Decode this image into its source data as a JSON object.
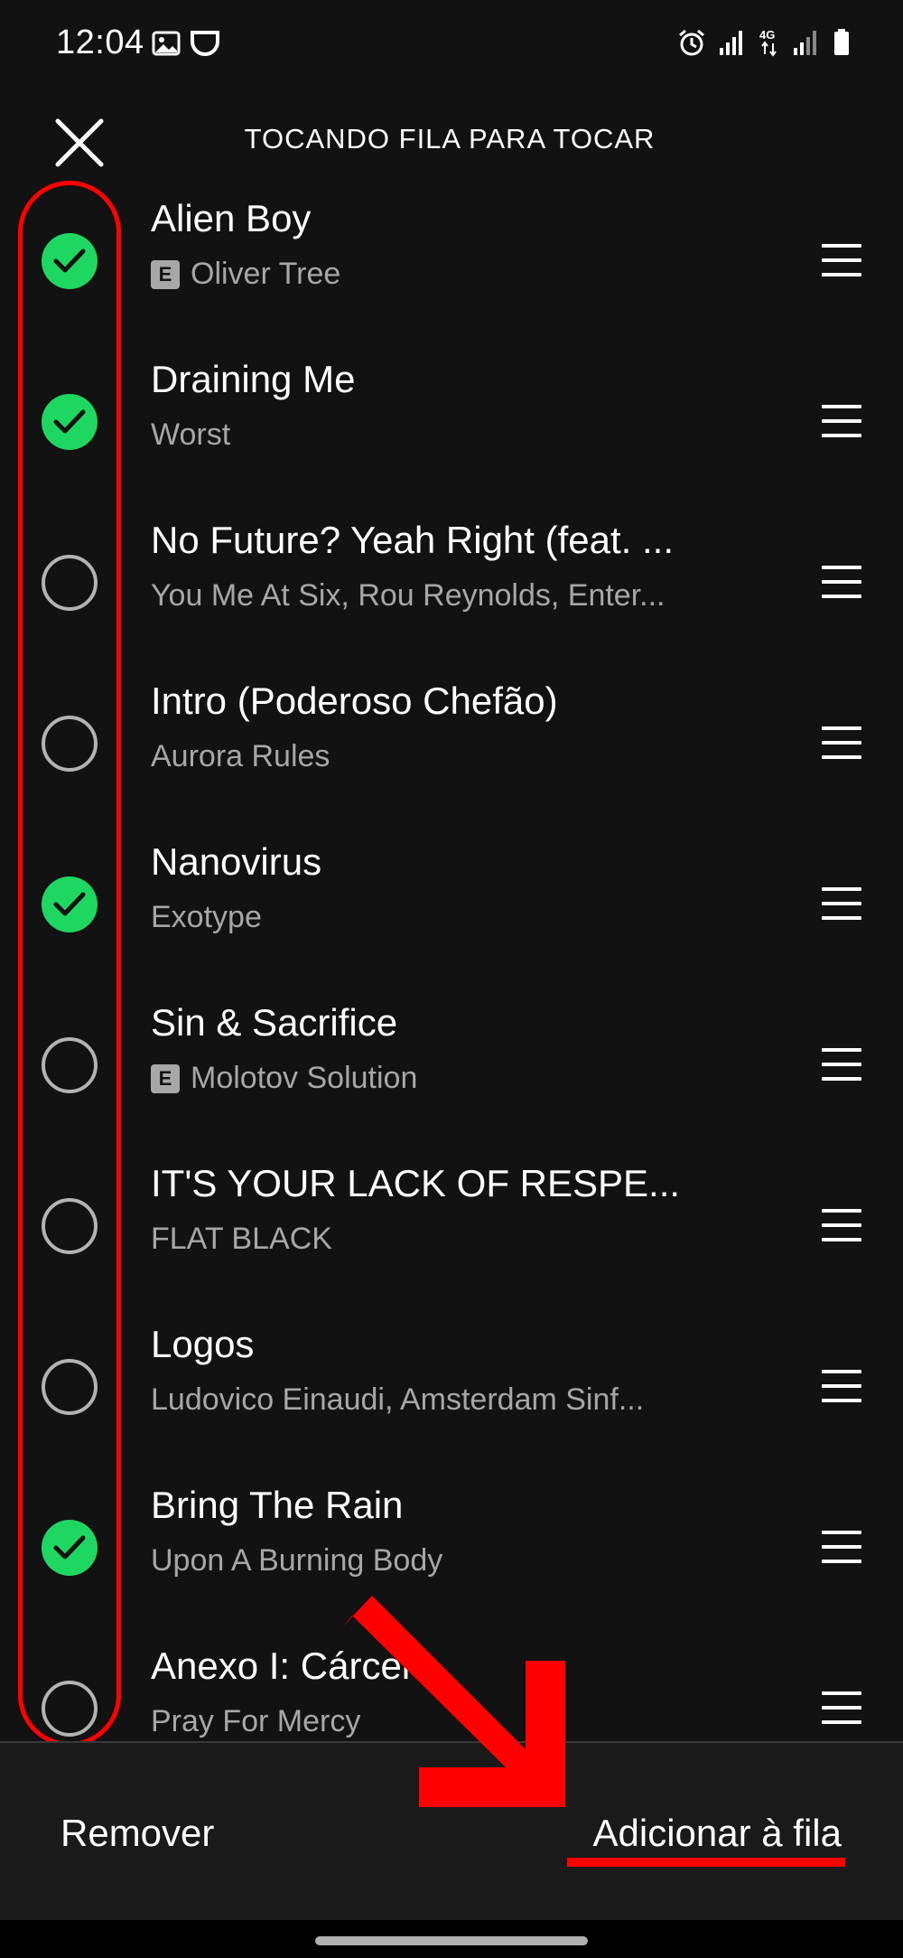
{
  "status_bar": {
    "time": "12:04"
  },
  "header": {
    "title": "TOCANDO FILA PARA TOCAR"
  },
  "tracks": [
    {
      "title": "Alien Boy",
      "artist": "Oliver Tree",
      "explicit": true,
      "selected": true
    },
    {
      "title": "Draining Me",
      "artist": "Worst",
      "explicit": false,
      "selected": true
    },
    {
      "title": "No Future? Yeah Right (feat. ...",
      "artist": "You Me At Six, Rou Reynolds, Enter...",
      "explicit": false,
      "selected": false
    },
    {
      "title": "Intro (Poderoso Chefão)",
      "artist": "Aurora Rules",
      "explicit": false,
      "selected": false
    },
    {
      "title": "Nanovirus",
      "artist": "Exotype",
      "explicit": false,
      "selected": true
    },
    {
      "title": "Sin & Sacrifice",
      "artist": "Molotov Solution",
      "explicit": true,
      "selected": false
    },
    {
      "title": "IT'S YOUR LACK OF RESPE...",
      "artist": "FLAT BLACK",
      "explicit": false,
      "selected": false
    },
    {
      "title": "Logos",
      "artist": "Ludovico Einaudi, Amsterdam Sinf...",
      "explicit": false,
      "selected": false
    },
    {
      "title": "Bring The Rain",
      "artist": "Upon A Burning Body",
      "explicit": false,
      "selected": true
    },
    {
      "title": "Anexo I: Cárcere",
      "artist": "Pray For Mercy",
      "explicit": false,
      "selected": false
    }
  ],
  "explicit_badge": "E",
  "actions": {
    "remove_label": "Remover",
    "add_label": "Adicionar à fila"
  },
  "colors": {
    "accent": "#1ed760",
    "annotation": "#ff0000",
    "background": "#121212"
  }
}
